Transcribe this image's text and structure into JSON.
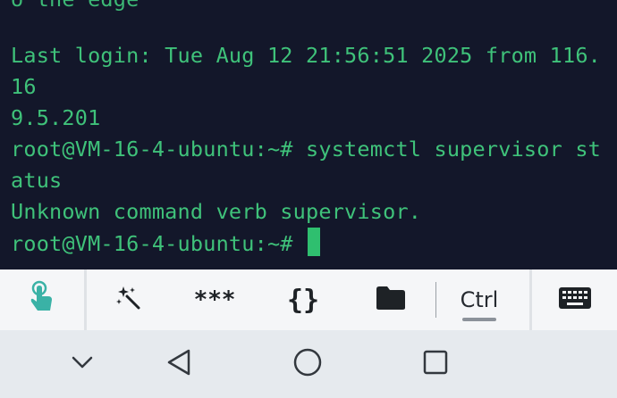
{
  "terminal": {
    "lines": [
      "Last login: Tue Aug 12 21:56:51 2025 from 116.",
      "16",
      "9.5.201",
      "root@VM-16-4-ubuntu:~# systemctl supervisor st",
      "atus",
      "Unknown command verb supervisor.",
      "root@VM-16-4-ubuntu:~# "
    ],
    "text_color": "#3fc27a",
    "background": "#13172a",
    "cursor_color": "#2fbf6f"
  },
  "toolbar": {
    "touch_icon": "touch-hand-icon",
    "magic_icon": "magic-wand-icon",
    "password_label": "***",
    "snippets_label": "{}",
    "folder_icon": "folder-icon",
    "ctrl_label": "Ctrl",
    "keyboard_icon": "keyboard-icon",
    "accent_color": "#3ab2a6"
  },
  "navbar": {
    "hide_icon": "chevron-down-icon",
    "back_icon": "back-triangle-icon",
    "home_icon": "home-circle-icon",
    "recents_icon": "recents-square-icon"
  }
}
